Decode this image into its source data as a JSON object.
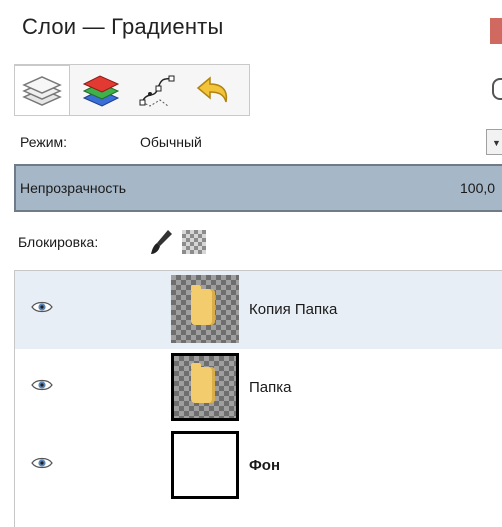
{
  "window": {
    "title": "Слои — Градиенты"
  },
  "tabs": [
    {
      "name": "layers-tab-icon",
      "active": true
    },
    {
      "name": "channels-tab-icon",
      "active": false
    },
    {
      "name": "paths-tab-icon",
      "active": false
    },
    {
      "name": "undo-history-tab-icon",
      "active": false
    }
  ],
  "mode": {
    "label": "Режим:",
    "value": "Обычный"
  },
  "opacity": {
    "label": "Непрозрачность",
    "value": "100,0"
  },
  "lock": {
    "label": "Блокировка:"
  },
  "layers": [
    {
      "name": "Копия Папка",
      "visible": true,
      "thumbnail": "transparent-with-folder",
      "bold": false
    },
    {
      "name": "Папка",
      "visible": true,
      "thumbnail": "transparent-with-folder",
      "bold": false
    },
    {
      "name": "Фон",
      "visible": true,
      "thumbnail": "white",
      "bold": true
    }
  ],
  "colors": {
    "opacity_bar": "#a6b7c7",
    "hover_row": "#e7eef5",
    "title_accent": "#d06a60"
  }
}
